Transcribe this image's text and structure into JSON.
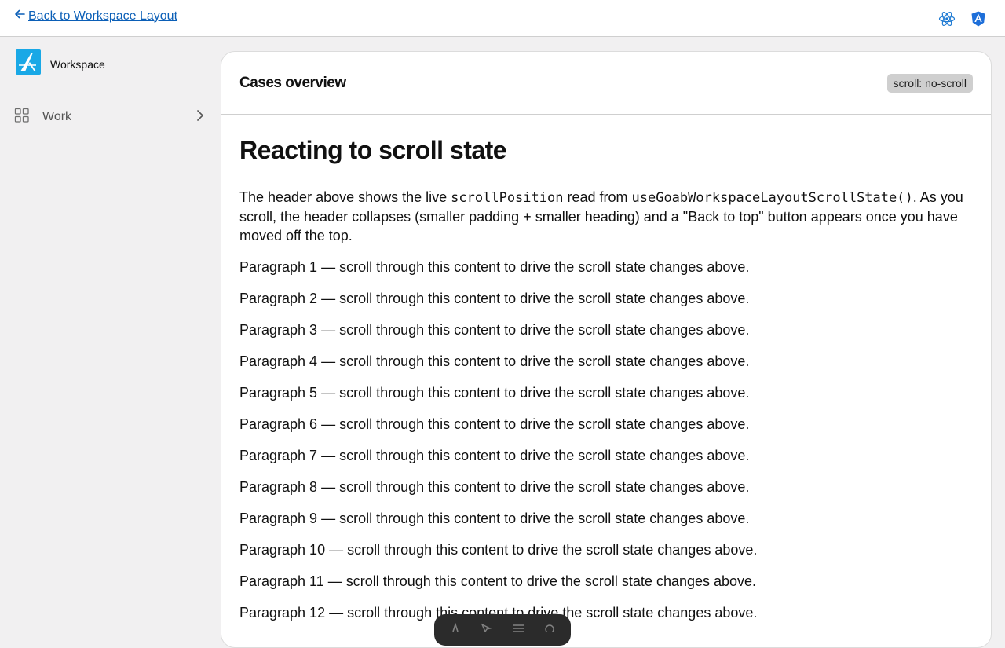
{
  "topbar": {
    "back_label": "Back to Workspace Layout",
    "icons": [
      "arrow-left-icon",
      "react-icon",
      "angular-icon"
    ],
    "colors": {
      "link": "#0b5fb7",
      "react": "#1e7ad3",
      "angular": "#1e6fd9"
    }
  },
  "sidebar": {
    "brand": {
      "name": "Workspace",
      "logo": "workspace-logo-icon",
      "color": "#19a8e6"
    },
    "items": [
      {
        "label": "Work",
        "icon": "grid-icon",
        "trailing_icon": "chevron-right-icon"
      }
    ]
  },
  "panel": {
    "title": "Cases overview",
    "badge": "scroll: no-scroll",
    "heading": "Reacting to scroll state",
    "intro": {
      "part1": "The header above shows the live ",
      "code1": "scrollPosition",
      "part2": " read from ",
      "code2": "useGoabWorkspaceLayoutScrollState()",
      "part3": ". As you scroll, the header collapses (smaller padding + smaller heading) and a \"Back to top\" button appears once you have moved off the top."
    },
    "paragraphs": [
      "Paragraph 1 — scroll through this content to drive the scroll state changes above.",
      "Paragraph 2 — scroll through this content to drive the scroll state changes above.",
      "Paragraph 3 — scroll through this content to drive the scroll state changes above.",
      "Paragraph 4 — scroll through this content to drive the scroll state changes above.",
      "Paragraph 5 — scroll through this content to drive the scroll state changes above.",
      "Paragraph 6 — scroll through this content to drive the scroll state changes above.",
      "Paragraph 7 — scroll through this content to drive the scroll state changes above.",
      "Paragraph 8 — scroll through this content to drive the scroll state changes above.",
      "Paragraph 9 — scroll through this content to drive the scroll state changes above.",
      "Paragraph 10 — scroll through this content to drive the scroll state changes above.",
      "Paragraph 11 — scroll through this content to drive the scroll state changes above.",
      "Paragraph 12 — scroll through this content to drive the scroll state changes above."
    ]
  },
  "dev_toolbar": {
    "icons": [
      "astro-icon",
      "cursor-icon",
      "menu-icon",
      "settings-icon"
    ]
  }
}
